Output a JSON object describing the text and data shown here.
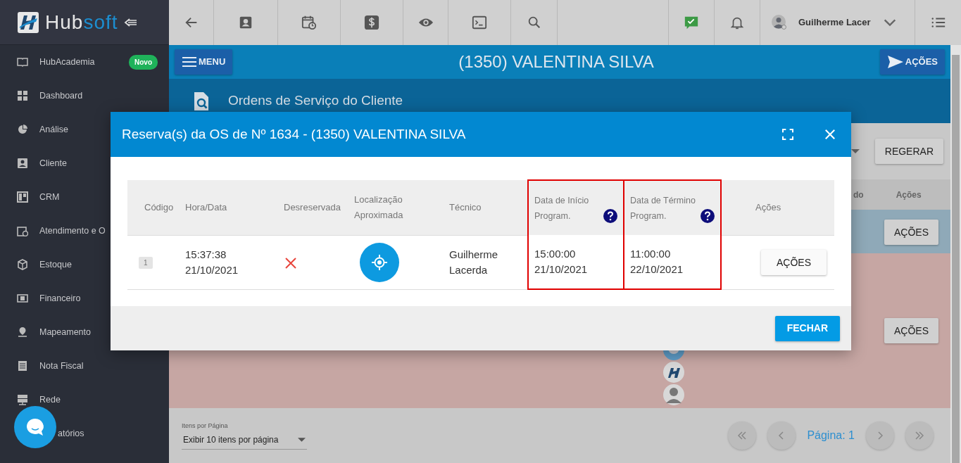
{
  "logo": {
    "parts": [
      "Hub",
      "soft"
    ]
  },
  "sidebar": {
    "items": [
      {
        "label": "HubAcademia",
        "badge": "Novo"
      },
      {
        "label": "Dashboard"
      },
      {
        "label": "Análise"
      },
      {
        "label": "Cliente"
      },
      {
        "label": "CRM"
      },
      {
        "label": "Atendimento e O"
      },
      {
        "label": "Estoque"
      },
      {
        "label": "Financeiro"
      },
      {
        "label": "Mapeamento"
      },
      {
        "label": "Nota Fiscal"
      },
      {
        "label": "Rede"
      },
      {
        "label": "atórios"
      }
    ]
  },
  "topbar": {
    "user": "Guilherme Lacer"
  },
  "header": {
    "menu_button": "MENU",
    "title": "(1350) VALENTINA SILVA",
    "actions_button": "AÇÕES"
  },
  "section_title": "Ordens de Serviço do Cliente",
  "background": {
    "regenerate_button": "REGERAR",
    "columns": [
      "do",
      "Ações"
    ],
    "rows": [
      {
        "color": "#8fa9b8",
        "button": "AÇÕES",
        "avatars": false
      },
      {
        "color": "#c6a6a3",
        "button": "AÇÕES",
        "avatars": true
      }
    ]
  },
  "pagination": {
    "label": "Itens por Página",
    "select": "Exibir 10 itens por página",
    "page": "Página: 1"
  },
  "modal": {
    "title": "Reserva(s) da OS de Nº 1634 - (1350) VALENTINA SILVA",
    "columns": [
      {
        "label": "Código",
        "help": false,
        "highlighted": false
      },
      {
        "label": "Hora/Data",
        "help": false,
        "highlighted": false
      },
      {
        "label": "Desreservada",
        "help": false,
        "highlighted": false
      },
      {
        "label": "Localização Aproximada",
        "help": false,
        "highlighted": false
      },
      {
        "label": "Técnico",
        "help": false,
        "highlighted": false
      },
      {
        "label": "Data de Início Program.",
        "help": true,
        "highlighted": true
      },
      {
        "label": "Data de Término Program.",
        "help": true,
        "highlighted": true
      },
      {
        "label": "Ações",
        "help": false,
        "highlighted": false
      }
    ],
    "rows": [
      {
        "code": "1",
        "time": "15:37:38",
        "date": "21/10/2021",
        "unreserved": false,
        "technician": "Guilherme Lacerda",
        "start_time": "15:00:00",
        "start_date": "21/10/2021",
        "end_time": "11:00:00",
        "end_date": "22/10/2021",
        "button": "AÇÕES"
      }
    ],
    "close_button": "FECHAR"
  }
}
